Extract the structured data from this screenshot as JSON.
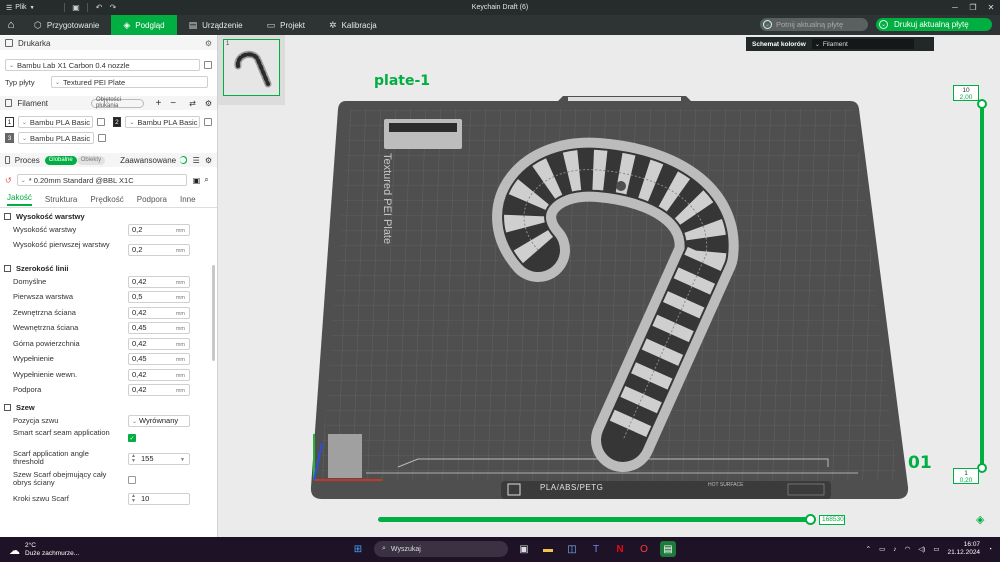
{
  "titlebar": {
    "menu_label": "Plik",
    "title": "Keychain Draft (6)"
  },
  "tabs": [
    {
      "label": "Przygotowanie"
    },
    {
      "label": "Podgląd"
    },
    {
      "label": "Urządzenie"
    },
    {
      "label": "Projekt"
    },
    {
      "label": "Kalibracja"
    }
  ],
  "actions": {
    "slice_label": "Potnij aktualną płytę",
    "print_label": "Drukuj aktualną płytę"
  },
  "printer": {
    "section_title": "Drukarka",
    "printer_name": "Bambu Lab X1 Carbon 0.4 nozzle",
    "plate_type_label": "Typ płyty",
    "plate_type_value": "Textured PEI Plate"
  },
  "filament": {
    "section_title": "Filament",
    "badge": "Objętości płukania",
    "slots": [
      {
        "num": "1",
        "name": "Bambu PLA Basic"
      },
      {
        "num": "2",
        "name": "Bambu PLA Basic"
      },
      {
        "num": "3",
        "name": "Bambu PLA Basic"
      }
    ]
  },
  "process": {
    "section_title": "Proces",
    "toggle_global": "Globalne",
    "toggle_objects": "Obiekty",
    "advanced_label": "Zaawansowane",
    "preset": "* 0.20mm Standard @BBL X1C",
    "subtabs": [
      "Jakość",
      "Struktura",
      "Prędkość",
      "Podpora",
      "Inne"
    ]
  },
  "settings": {
    "group_layer_height": "Wysokość warstwy",
    "layer_height": {
      "label": "Wysokość warstwy",
      "value": "0,2",
      "unit": "mm"
    },
    "first_layer_height": {
      "label": "Wysokość pierwszej warstwy",
      "value": "0,2",
      "unit": "mm"
    },
    "group_line_width": "Szerokość linii",
    "line_widths": [
      {
        "label": "Domyślne",
        "value": "0,42",
        "unit": "mm"
      },
      {
        "label": "Pierwsza warstwa",
        "value": "0,5",
        "unit": "mm"
      },
      {
        "label": "Zewnętrzna ściana",
        "value": "0,42",
        "unit": "mm"
      },
      {
        "label": "Wewnętrzna ściana",
        "value": "0,45",
        "unit": "mm"
      },
      {
        "label": "Górna powierzchnia",
        "value": "0,42",
        "unit": "mm"
      },
      {
        "label": "Wypełnienie",
        "value": "0,45",
        "unit": "mm"
      },
      {
        "label": "Wypełnienie wewn.",
        "value": "0,42",
        "unit": "mm"
      },
      {
        "label": "Podpora",
        "value": "0,42",
        "unit": "mm"
      }
    ],
    "group_seam": "Szew",
    "seam_position": {
      "label": "Pozycja szwu",
      "value": "Wyrównany"
    },
    "smart_scarf": {
      "label": "Smart scarf seam application"
    },
    "scarf_threshold": {
      "label": "Scarf application angle threshold",
      "value": "155"
    },
    "scarf_inner": {
      "label": "Szew Scarf obejmujący cały obrys ściany"
    },
    "scarf_steps": {
      "label": "Kroki szwu Scarf",
      "value": "10"
    }
  },
  "viewport": {
    "plate_label": "plate-1",
    "plate_number": "01",
    "color_scheme_label": "Schemat kolorów",
    "color_scheme_value": "Filament",
    "plate_texture_text": "Textured PEI Plate",
    "plate_material_text": "PLA/ABS/PETG",
    "plate_hot_text": "HOT SURFACE",
    "layer_top": {
      "layer": "10",
      "height": "2,00"
    },
    "layer_bottom": {
      "layer": "1",
      "height": "0,20"
    },
    "move_value": "168530",
    "thumb_number": "1"
  },
  "taskbar": {
    "weather_temp": "2°C",
    "weather_desc": "Duże zachmurze...",
    "search_placeholder": "Wyszukaj",
    "time": "16:07",
    "date": "21.12.2024"
  },
  "colors": {
    "accent": "#00ae42",
    "titlebar": "#262b2b",
    "tabbar": "#2e3333",
    "plate": "#525252"
  }
}
